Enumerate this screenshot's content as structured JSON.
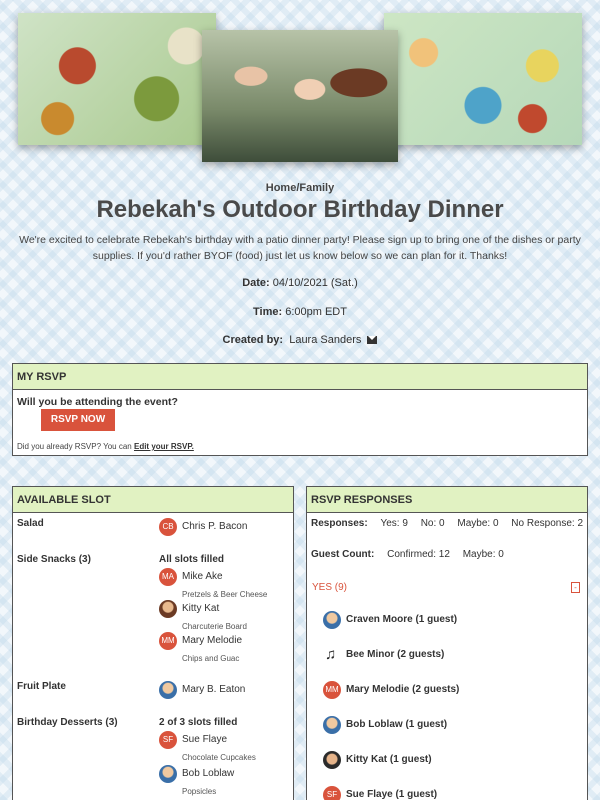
{
  "page": {
    "breadcrumb": "Home/Family",
    "title": "Rebekah's Outdoor Birthday Dinner",
    "description": "We're excited to celebrate Rebekah's birthday with a patio dinner party! Please sign up to bring one of the dishes or party supplies. If you'd rather BYOF (food) just let us know below so we can plan for it. Thanks!",
    "date_label": "Date:",
    "date_value": "04/10/2021 (Sat.)",
    "time_label": "Time:",
    "time_value": "6:00pm EDT",
    "created_label": "Created by:",
    "created_value": "Laura Sanders"
  },
  "rsvp": {
    "header": "MY RSVP",
    "question": "Will you be attending the event?",
    "button": "RSVP NOW",
    "note_prefix": "Did you already RSVP? You can",
    "note_link": "Edit your RSVP."
  },
  "slots": {
    "header": "AVAILABLE SLOT",
    "rows": [
      {
        "name": "Salad",
        "status": "",
        "signups": [
          {
            "initials": "CB",
            "name": "Chris P. Bacon",
            "note": ""
          }
        ]
      },
      {
        "name": "Side Snacks (3)",
        "status": "All slots filled",
        "signups": [
          {
            "initials": "MA",
            "name": "Mike Ake",
            "note": "Pretzels & Beer Cheese"
          },
          {
            "initials": "",
            "name": "Kitty Kat",
            "note": "Charcuterie Board"
          },
          {
            "initials": "MM",
            "name": "Mary Melodie",
            "note": "Chips and Guac"
          }
        ]
      },
      {
        "name": "Fruit Plate",
        "status": "",
        "signups": [
          {
            "initials": "",
            "name": "Mary B. Eaton",
            "note": ""
          }
        ]
      },
      {
        "name": "Birthday Desserts (3)",
        "status": "2 of 3 slots filled",
        "signups": [
          {
            "initials": "SF",
            "name": "Sue Flaye",
            "note": "Chocolate Cupcakes"
          },
          {
            "initials": "",
            "name": "Bob Loblaw",
            "note": "Popsicles"
          }
        ]
      }
    ]
  },
  "responses": {
    "header": "RSVP RESPONSES",
    "responses_label": "Responses:",
    "yes": "Yes: 9",
    "no": "No: 0",
    "maybe": "Maybe: 0",
    "no_response": "No Response: 2",
    "guest_count_label": "Guest Count:",
    "confirmed": "Confirmed: 12",
    "guest_maybe": "Maybe: 0",
    "yes_group": "YES (9)",
    "collapse": "-",
    "guests": [
      {
        "initials": "",
        "name": "Craven Moore (1 guest)"
      },
      {
        "initials": "",
        "name": "Bee Minor (2 guests)"
      },
      {
        "initials": "MM",
        "name": "Mary Melodie (2 guests)"
      },
      {
        "initials": "",
        "name": "Bob Loblaw (1 guest)"
      },
      {
        "initials": "",
        "name": "Kitty Kat (1 guest)"
      },
      {
        "initials": "SF",
        "name": "Sue Flaye (1 guest)"
      }
    ]
  },
  "colors": {
    "accent": "#d9533c",
    "panel_header": "#e1f2c2"
  }
}
